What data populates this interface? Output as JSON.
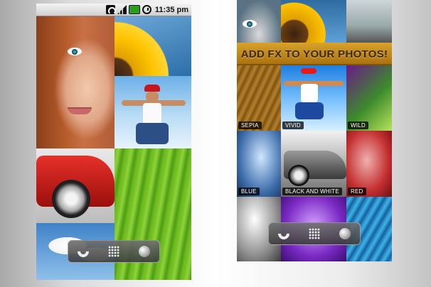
{
  "status_bar": {
    "time": "11:35 pm"
  },
  "banner": {
    "text": "ADD FX TO YOUR PHOTOS!"
  },
  "filters": [
    "SEPIA",
    "VIVID",
    "WILD",
    "BLUE",
    "BLACK AND WHITE",
    "RED"
  ],
  "dock": {
    "icons": [
      "phone-icon",
      "app-grid-icon",
      "browser-icon"
    ]
  },
  "colors": {
    "banner": "#c38b1f",
    "statusbar": "#e6e6e6",
    "battery": "#2e9e1a"
  }
}
